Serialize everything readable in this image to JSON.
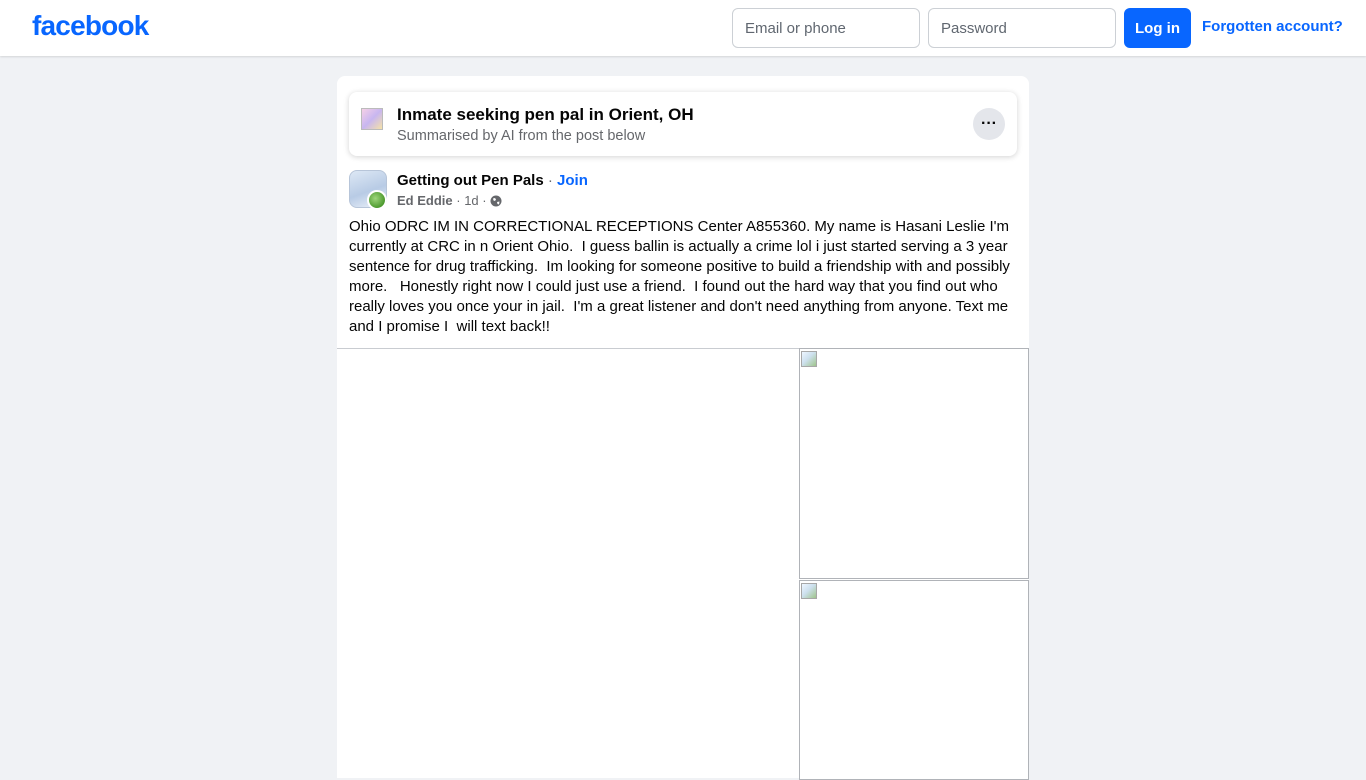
{
  "header": {
    "logo_text": "facebook",
    "email_placeholder": "Email or phone",
    "password_placeholder": "Password",
    "login_label": "Log in",
    "forgot_label": "Forgotten account?"
  },
  "summary": {
    "title": "Inmate seeking pen pal in Orient, OH",
    "subtitle": "Summarised by AI from the post below",
    "more_label": "···"
  },
  "post": {
    "group_name": "Getting out Pen Pals",
    "separator": " · ",
    "join_label": "Join",
    "author": "Ed Eddie",
    "time": "1d",
    "meta_separator": " · ",
    "text": "Ohio ODRC IM IN CORRECTIONAL RECEPTIONS Center A855360. My name is Hasani Leslie I'm currently at CRC in n Orient Ohio.  I guess ballin is actually a crime lol i just started serving a 3 year sentence for drug trafficking.  Im looking for someone positive to build a friendship with and possibly more.   Honestly right now I could just use a friend.  I found out the hard way that you find out who really loves you once your in jail.  I'm a great listener and don't need anything from anyone. Text me and I promise I  will text back!!"
  },
  "colors": {
    "brand": "#0866ff",
    "page_background": "#f0f2f5",
    "secondary_text": "#65676b"
  },
  "icons": {
    "summary": "ai-summary-icon",
    "more": "more-options-icon",
    "visibility": "globe-icon",
    "photo_placeholder": "broken-image-icon"
  }
}
